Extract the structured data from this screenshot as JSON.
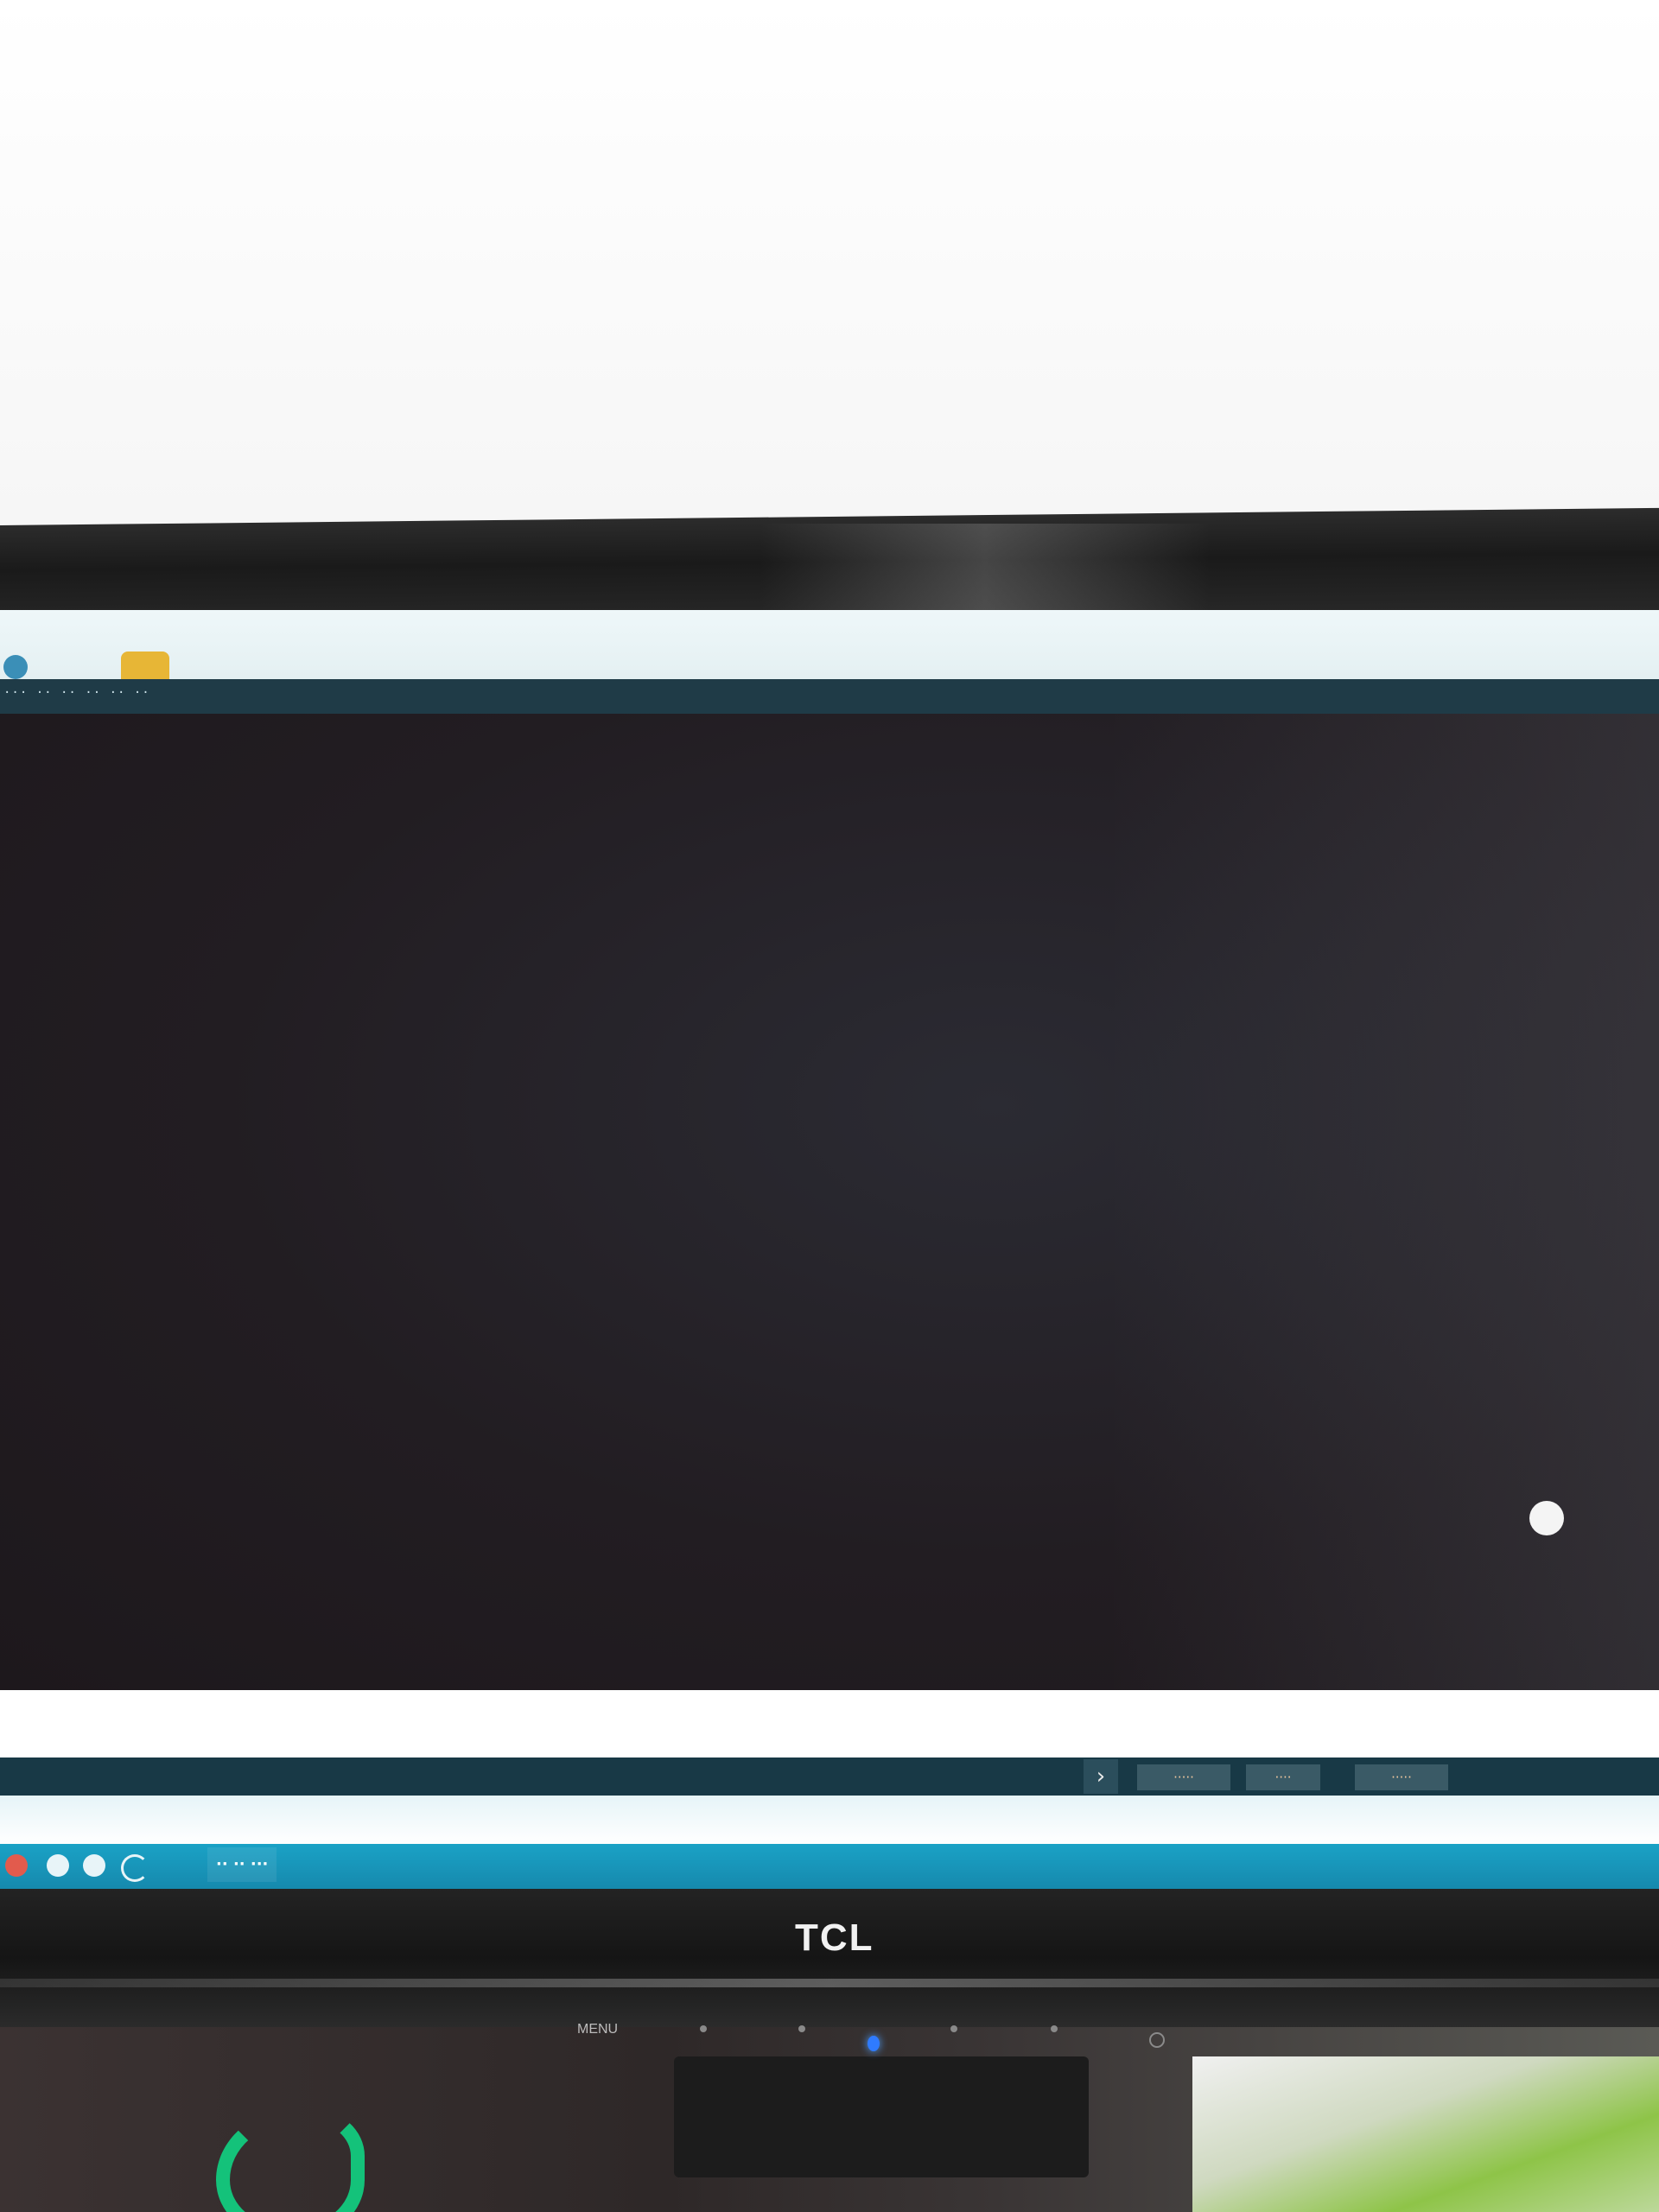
{
  "toolbar": {
    "text": "··· ·· ·· ·· ·· ··"
  },
  "status_bar": {
    "arrow": "›",
    "buttons": [
      "·····",
      "····",
      "·····"
    ]
  },
  "taskbar": {
    "task_label": "·· ·· ···"
  },
  "monitor": {
    "brand": "TCL",
    "menu_label": "MENU"
  },
  "colors": {
    "canvas": "#221d22",
    "status_bar": "#183946",
    "taskbar": "#1aa2c6",
    "power_led": "#2f7bff"
  },
  "icons": {
    "app_icon": "app-icon",
    "app_icon_2": "folder-icon",
    "cursor": "pointer-icon",
    "status_arrow": "chevron-right-icon"
  }
}
